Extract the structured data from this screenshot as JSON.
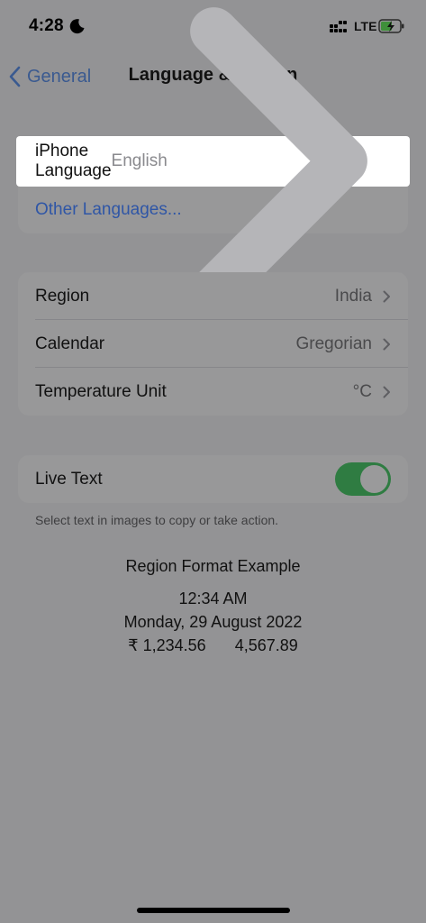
{
  "status": {
    "time": "4:28",
    "network": "LTE",
    "icons": [
      "moon-icon",
      "signal-icon",
      "battery-charging-icon"
    ]
  },
  "nav": {
    "back_label": "General",
    "title": "Language & Region"
  },
  "languages": {
    "iphone_language_label": "iPhone Language",
    "iphone_language_value": "English",
    "other_languages_label": "Other Languages..."
  },
  "region_group": {
    "region_label": "Region",
    "region_value": "India",
    "calendar_label": "Calendar",
    "calendar_value": "Gregorian",
    "temperature_label": "Temperature Unit",
    "temperature_value": "°C"
  },
  "live_text": {
    "label": "Live Text",
    "enabled": true,
    "footnote": "Select text in images to copy or take action."
  },
  "region_example": {
    "title": "Region Format Example",
    "time": "12:34 AM",
    "date": "Monday, 29 August 2022",
    "currency": "₹ 1,234.56",
    "number": "4,567.89"
  },
  "colors": {
    "accent": "#2f56a6",
    "toggle_on": "#2f7c42",
    "dim_background": "#939395"
  }
}
